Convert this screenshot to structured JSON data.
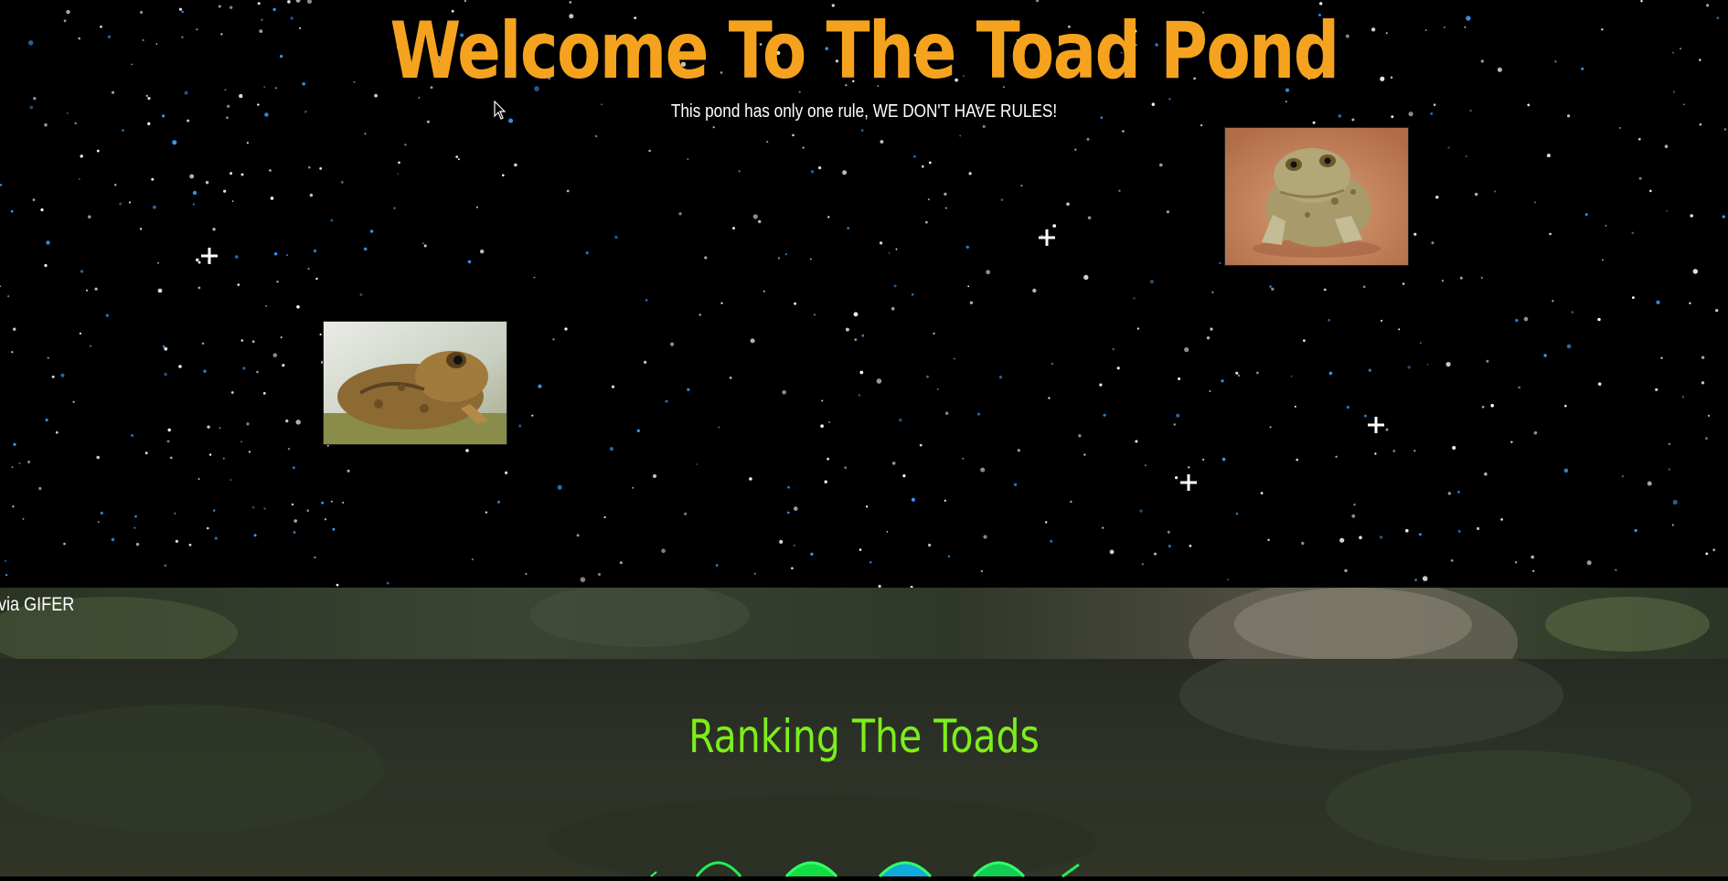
{
  "hero": {
    "title": "Welcome To The Toad Pond",
    "subtitle": "This pond has only one rule, WE DON'T HAVE RULES!"
  },
  "gif_band": {
    "credit": "via GIFER"
  },
  "ranking": {
    "title": "Ranking The Toads"
  },
  "colors": {
    "title_orange": "#f5a31f",
    "ranking_green": "#7dee1a",
    "background": "#000000"
  }
}
